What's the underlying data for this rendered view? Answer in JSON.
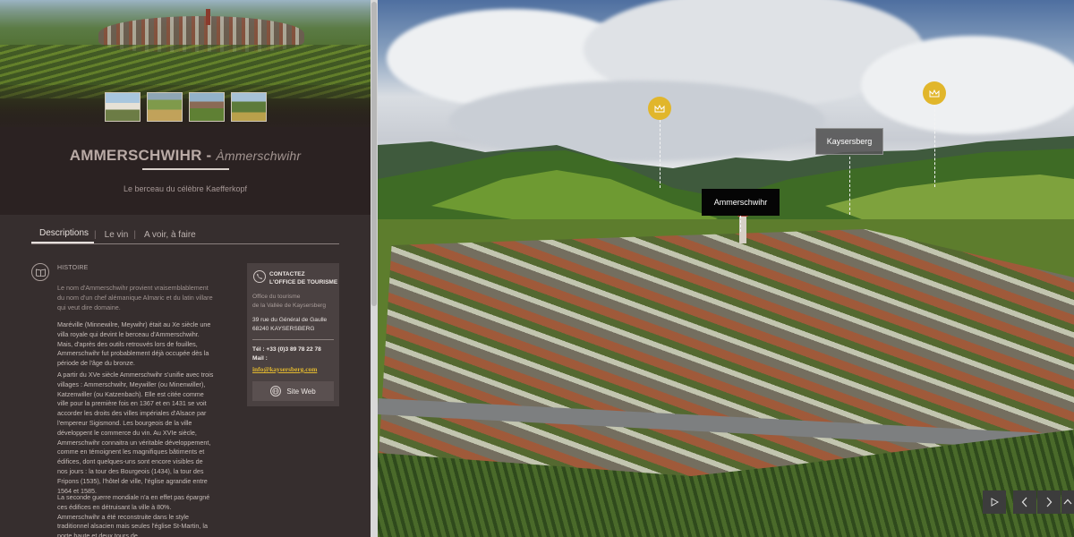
{
  "header": {
    "title_main": "AMMERSCHWIHR",
    "title_sep": " - ",
    "title_alsatian": "Àmmerschwihr",
    "tagline": "Le berceau du célèbre Kaefferkopf"
  },
  "tabs": [
    {
      "label": "Descriptions"
    },
    {
      "label": "Le vin"
    },
    {
      "label": "A voir, à faire"
    }
  ],
  "tab_separator": "|",
  "history": {
    "label": "HISTOIRE",
    "lead": "Le nom d'Ammerschwihr provient vraisemblablement du nom d'un chef alémanique Almaric et du latin villare qui veut dire domaine.",
    "p1": "Maréville (Minnewilre, Meywihr) était au Xe siècle une villa royale qui devint le berceau d'Ammerschwihr. Mais, d'après des outils retrouvés lors de fouilles, Ammerschwihr fut probablement déjà occupée dès la période de l'âge du bronze.",
    "p2": "A partir du XVe siècle Ammerschwihr s'unifie avec trois villages : Ammerschwihr, Meywiller (ou Minenwiller), Katzenwiller (ou Katzenbach). Elle est citée comme ville pour la première fois en 1367 et en 1431 se voit accorder les droits des villes impériales d'Alsace par l'empereur Sigismond. Les bourgeois de la ville développent le commerce du vin. Au XVIe siècle, Ammerschwihr connaitra un véritable développement, comme en témoignent les magnifiques bâtiments et édifices, dont quelques-uns sont encore visibles de nos jours : la tour des Bourgeois (1434), la tour des Fripons (1535), l'hôtel de ville, l'église agrandie entre 1564 et 1585.",
    "p3": "La seconde guerre mondiale n'a en effet pas épargné ces édifices en détruisant la ville à 80%. Ammerschwihr a été reconstruite dans le style traditionnel alsacien mais seules l'église St-Martin, la porte haute et deux tours de"
  },
  "contact": {
    "heading_line1": "CONTACTEZ",
    "heading_line2": "L'OFFICE DE TOURISME",
    "org_line1": "Office du tourisme",
    "org_line2": "de la Vallée de Kaysersberg",
    "addr_line1": "39 rue du Général de Gaulle",
    "addr_line2": "68240 KAYSERSBERG",
    "tel": "Tél : +33 (0)3 89 78 22 78",
    "mail_label": "Mail :",
    "mail": "info@kaysersberg.com",
    "site_button": "Site Web"
  },
  "panorama": {
    "label_ammerschwihr": "Ammerschwihr",
    "label_kaysersberg": "Kaysersberg"
  },
  "icons": {
    "hotspot": "crown-icon",
    "history": "book-icon",
    "contact": "phone-icon",
    "site": "globe-icon",
    "play": "play-icon",
    "prev": "chevron-left-icon",
    "next": "chevron-right-icon",
    "up": "chevron-up-icon"
  },
  "colors": {
    "accent": "#e1b62b",
    "panel": "#362e2e"
  }
}
